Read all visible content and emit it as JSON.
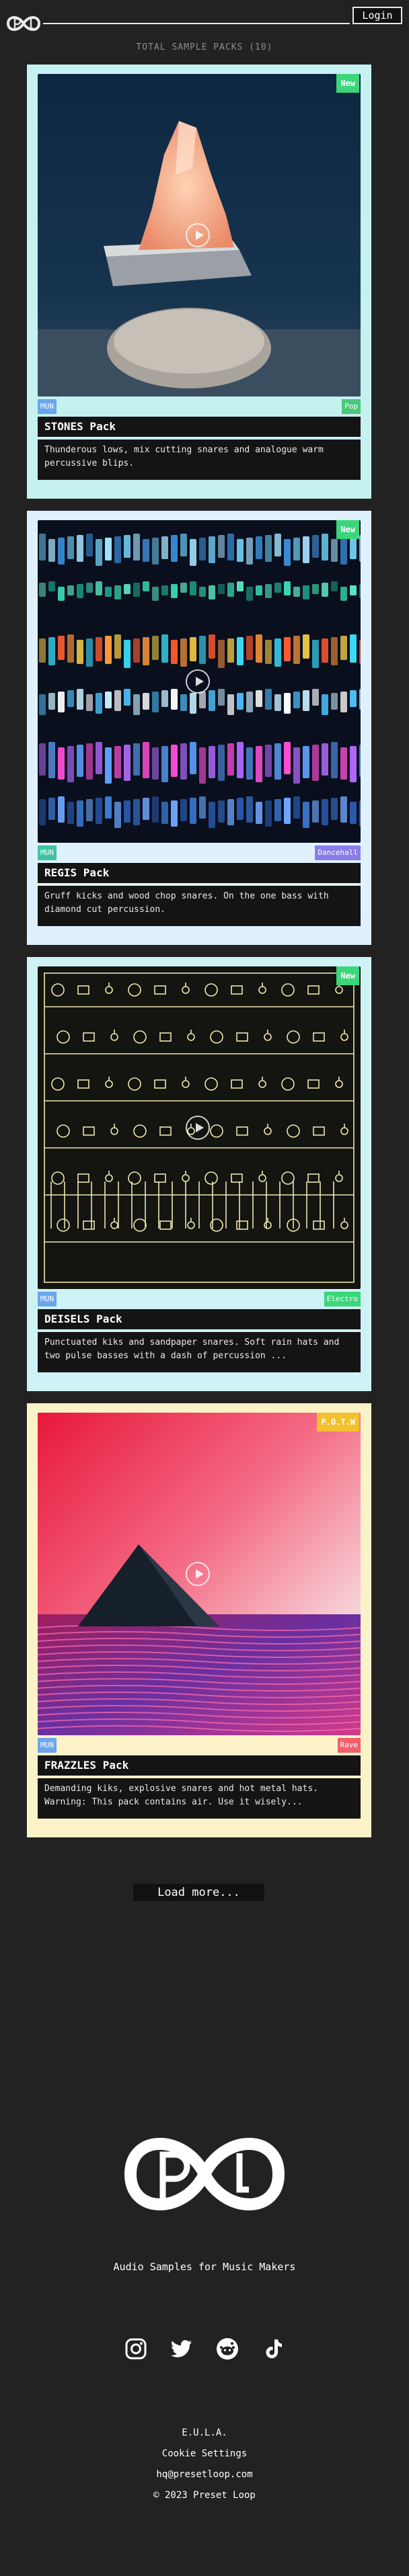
{
  "header": {
    "login_label": "Login"
  },
  "total_label": "TOTAL SAMPLE PACKS (10)",
  "packs": [
    {
      "title": "STONES Pack",
      "desc": "Thunderous lows, mix cutting snares and analogue warm percussive blips.",
      "corner_badge": "New",
      "tag_left": "MUN",
      "tag_right": "Pop",
      "colors": {
        "card_bg": "#c5f1f1",
        "corner_badge": "#3bd67a",
        "tag_left": "#6aa6ec",
        "tag_right": "#4cc77b"
      }
    },
    {
      "title": "REGIS Pack",
      "desc": "Gruff kicks and wood chop snares. On the one bass with diamond cut percussion.",
      "corner_badge": "New",
      "tag_left": "MUN",
      "tag_right": "Dancehall",
      "colors": {
        "card_bg": "#dff1ff",
        "corner_badge": "#3bd67a",
        "tag_left": "#3fc4a0",
        "tag_right": "#8b7de8"
      }
    },
    {
      "title": "DEISELS Pack",
      "desc": "Punctuated kiks and sandpaper snares. Soft rain hats and two pulse basses with a dash of percussion ...",
      "corner_badge": "New",
      "tag_left": "MUN",
      "tag_right": "Electro",
      "colors": {
        "card_bg": "#cff2f6",
        "corner_badge": "#3bd67a",
        "tag_left": "#6aa6ec",
        "tag_right": "#3bd67a"
      }
    },
    {
      "title": "FRAZZLES Pack",
      "desc": "Demanding kiks, explosive snares and hot metal hats. Warning: This pack contains air. Use it wisely...",
      "corner_badge": "P.O.T.W",
      "tag_left": "MUN",
      "tag_right": "Rave",
      "colors": {
        "card_bg": "#fbf2c8",
        "corner_badge": "#f2c12e",
        "tag_left": "#6aa6ec",
        "tag_right": "#f0606d"
      }
    }
  ],
  "load_more_label": "Load more...",
  "footer": {
    "tagline": "Audio Samples for Music Makers",
    "social_icons": [
      "instagram-icon",
      "twitter-icon",
      "reddit-icon",
      "tiktok-icon"
    ],
    "links": [
      "E.U.L.A.",
      "Cookie Settings",
      "hq@presetloop.com",
      "© 2023 Preset Loop"
    ]
  }
}
